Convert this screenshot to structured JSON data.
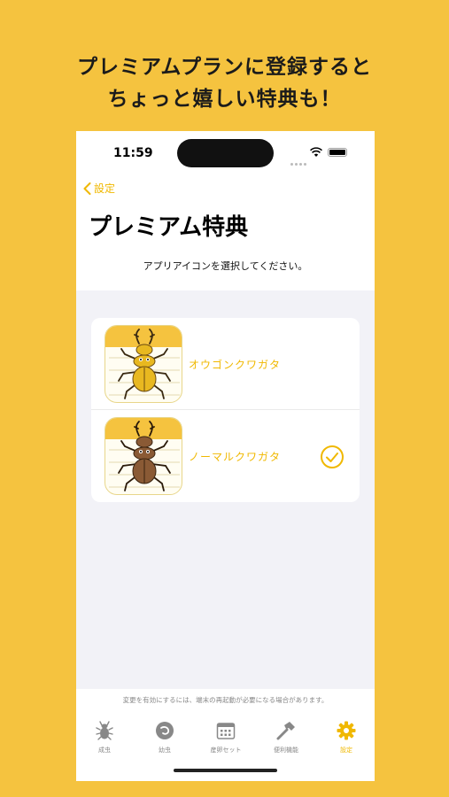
{
  "headline": {
    "line1": "プレミアムプランに登録すると",
    "line2": "ちょっと嬉しい特典も！"
  },
  "status_bar": {
    "time": "11:59"
  },
  "nav": {
    "back_label": "設定",
    "title": "プレミアム特典",
    "subtitle": "アプリアイコンを選択してください。"
  },
  "icon_options": [
    {
      "label": "オウゴンクワガタ",
      "beetle_color": "#e8b820",
      "selected": false
    },
    {
      "label": "ノーマルクワガタ",
      "beetle_color": "#8a5a35",
      "selected": true
    }
  ],
  "footer_note": "変更を有効にするには、端末の再起動が必要になる場合があります。",
  "tabs": [
    {
      "label": "成虫",
      "icon": "beetle-icon",
      "active": false
    },
    {
      "label": "幼虫",
      "icon": "larva-icon",
      "active": false
    },
    {
      "label": "産卵セット",
      "icon": "calendar-icon",
      "active": false
    },
    {
      "label": "便利機能",
      "icon": "hammer-icon",
      "active": false
    },
    {
      "label": "設定",
      "icon": "gear-icon",
      "active": true
    }
  ],
  "colors": {
    "accent": "#f0b800",
    "background": "#f5c33f"
  }
}
